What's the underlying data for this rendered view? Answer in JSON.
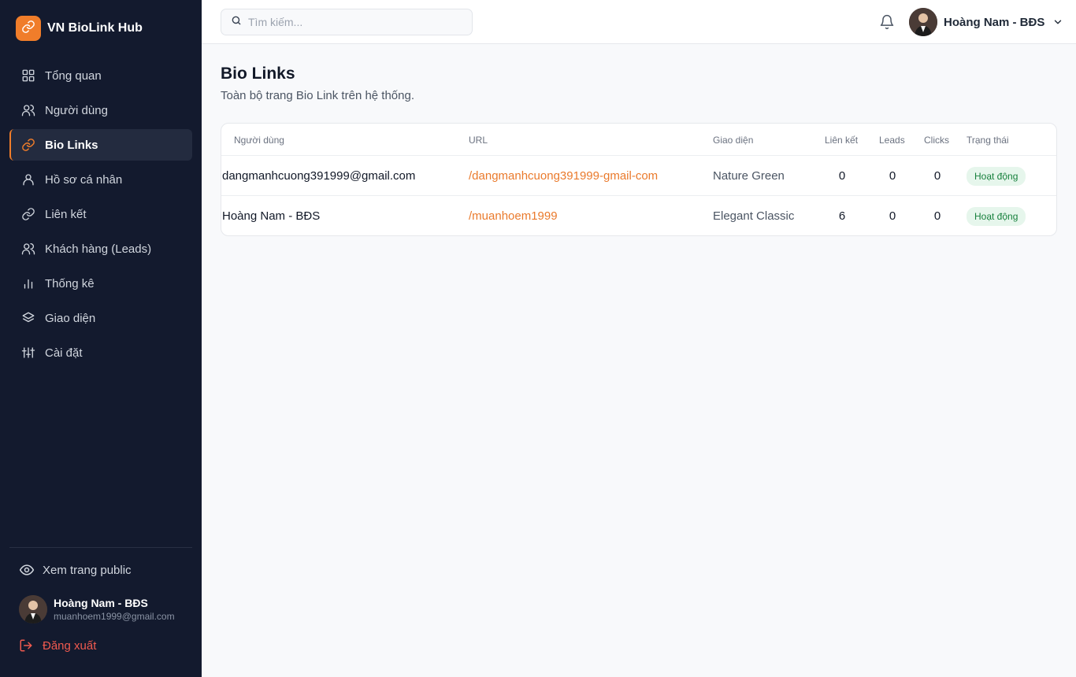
{
  "brand": {
    "name": "VN BioLink Hub",
    "logo_icon": "link-icon",
    "accent": "#f07d2a"
  },
  "sidebar": {
    "items": [
      {
        "label": "Tổng quan",
        "icon": "grid-icon",
        "active": false
      },
      {
        "label": "Người dùng",
        "icon": "users-icon",
        "active": false
      },
      {
        "label": "Bio Links",
        "icon": "link-icon",
        "active": true
      },
      {
        "label": "Hồ sơ cá nhân",
        "icon": "user-icon",
        "active": false
      },
      {
        "label": "Liên kết",
        "icon": "link-icon",
        "active": false
      },
      {
        "label": "Khách hàng (Leads)",
        "icon": "users-icon",
        "active": false
      },
      {
        "label": "Thống kê",
        "icon": "bar-chart-icon",
        "active": false
      },
      {
        "label": "Giao diện",
        "icon": "layers-icon",
        "active": false
      },
      {
        "label": "Cài đặt",
        "icon": "sliders-icon",
        "active": false
      }
    ],
    "public_link_label": "Xem trang public",
    "user": {
      "name": "Hoàng Nam - BĐS",
      "email": "muanhoem1999@gmail.com"
    },
    "logout_label": "Đăng xuất"
  },
  "topbar": {
    "search_placeholder": "Tìm kiếm...",
    "user_name": "Hoàng Nam - BĐS"
  },
  "main": {
    "title": "Bio Links",
    "subtitle": "Toàn bộ trang Bio Link trên hệ thống.",
    "table": {
      "headers": {
        "user": "Người dùng",
        "url": "URL",
        "theme": "Giao diện",
        "links": "Liên kết",
        "leads": "Leads",
        "clicks": "Clicks",
        "status": "Trạng thái"
      },
      "rows": [
        {
          "user": "dangmanhcuong391999@gmail.com",
          "url": "/dangmanhcuong391999-gmail-com",
          "theme": "Nature Green",
          "links": "0",
          "leads": "0",
          "clicks": "0",
          "status": "Hoạt động"
        },
        {
          "user": "Hoàng Nam - BĐS",
          "url": "/muanhoem1999",
          "theme": "Elegant Classic",
          "links": "6",
          "leads": "0",
          "clicks": "0",
          "status": "Hoạt động"
        }
      ]
    }
  },
  "colors": {
    "sidebar_bg": "#131a2e",
    "accent": "#f07d2a",
    "status_green": "#16803c",
    "logout_red": "#f05a4f"
  }
}
